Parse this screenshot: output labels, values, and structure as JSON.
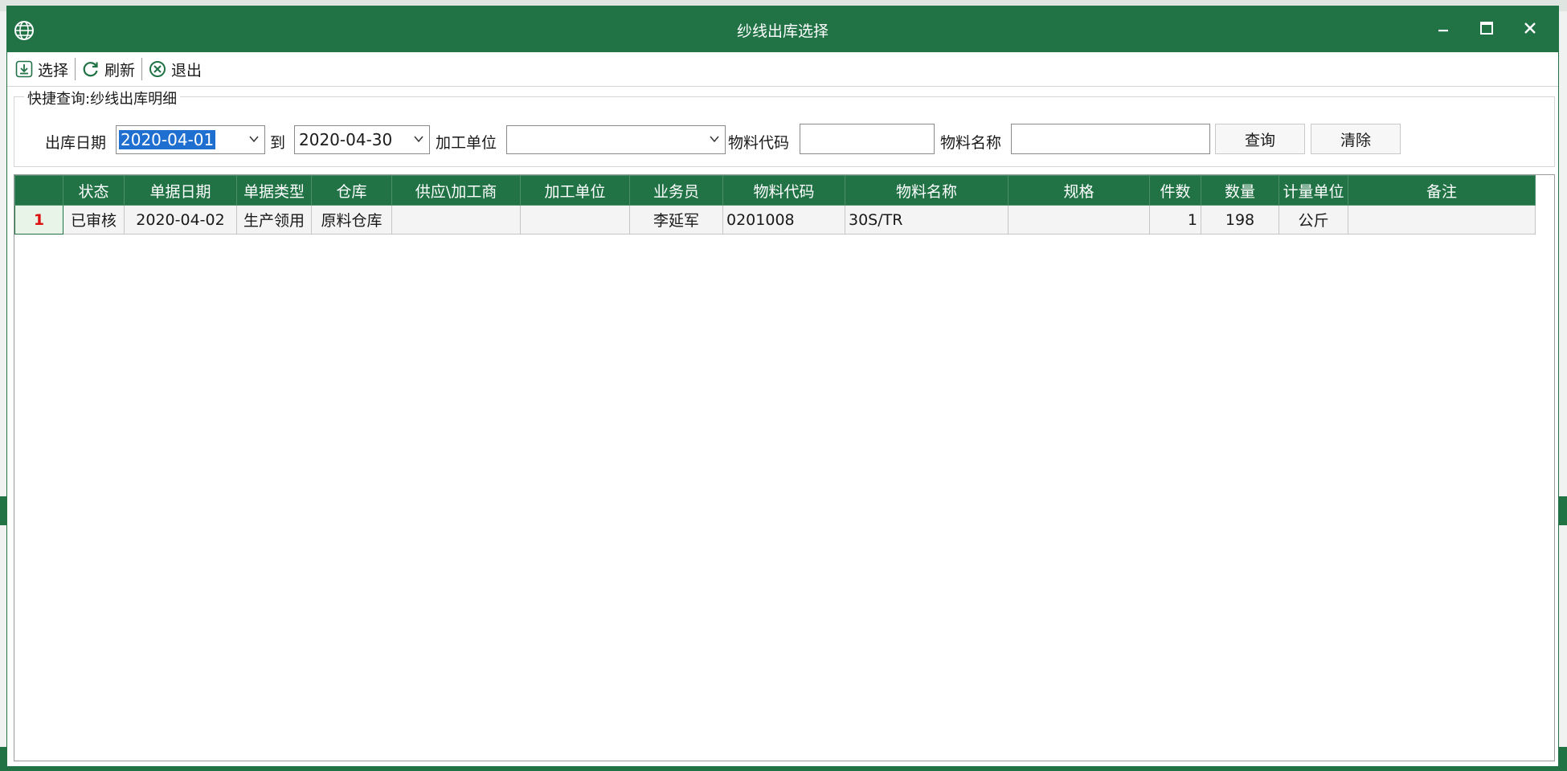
{
  "window": {
    "title": "纱线出库选择"
  },
  "toolbar": {
    "select_label": "选择",
    "refresh_label": "刷新",
    "exit_label": "退出"
  },
  "query": {
    "legend": "快捷查询:纱线出库明细",
    "date_label": "出库日期",
    "date_from": "2020-04-01",
    "to_label": "到",
    "date_to": "2020-04-30",
    "unit_label": "加工单位",
    "unit_value": "",
    "code_label": "物料代码",
    "code_value": "",
    "name_label": "物料名称",
    "name_value": "",
    "search_button": "查询",
    "clear_button": "清除"
  },
  "grid": {
    "columns": [
      "",
      "状态",
      "单据日期",
      "单据类型",
      "仓库",
      "供应\\加工商",
      "加工单位",
      "业务员",
      "物料代码",
      "物料名称",
      "规格",
      "件数",
      "数量",
      "计量单位",
      "备注"
    ],
    "rows": [
      [
        "1",
        "已审核",
        "2020-04-02",
        "生产领用",
        "原料仓库",
        "",
        "",
        "李延军",
        "0201008",
        "30S/TR",
        "",
        "1",
        "198",
        "公斤",
        ""
      ]
    ]
  },
  "colors": {
    "accent": "#217346",
    "selection": "#1f6fd1",
    "row_number": "#dd1111"
  }
}
